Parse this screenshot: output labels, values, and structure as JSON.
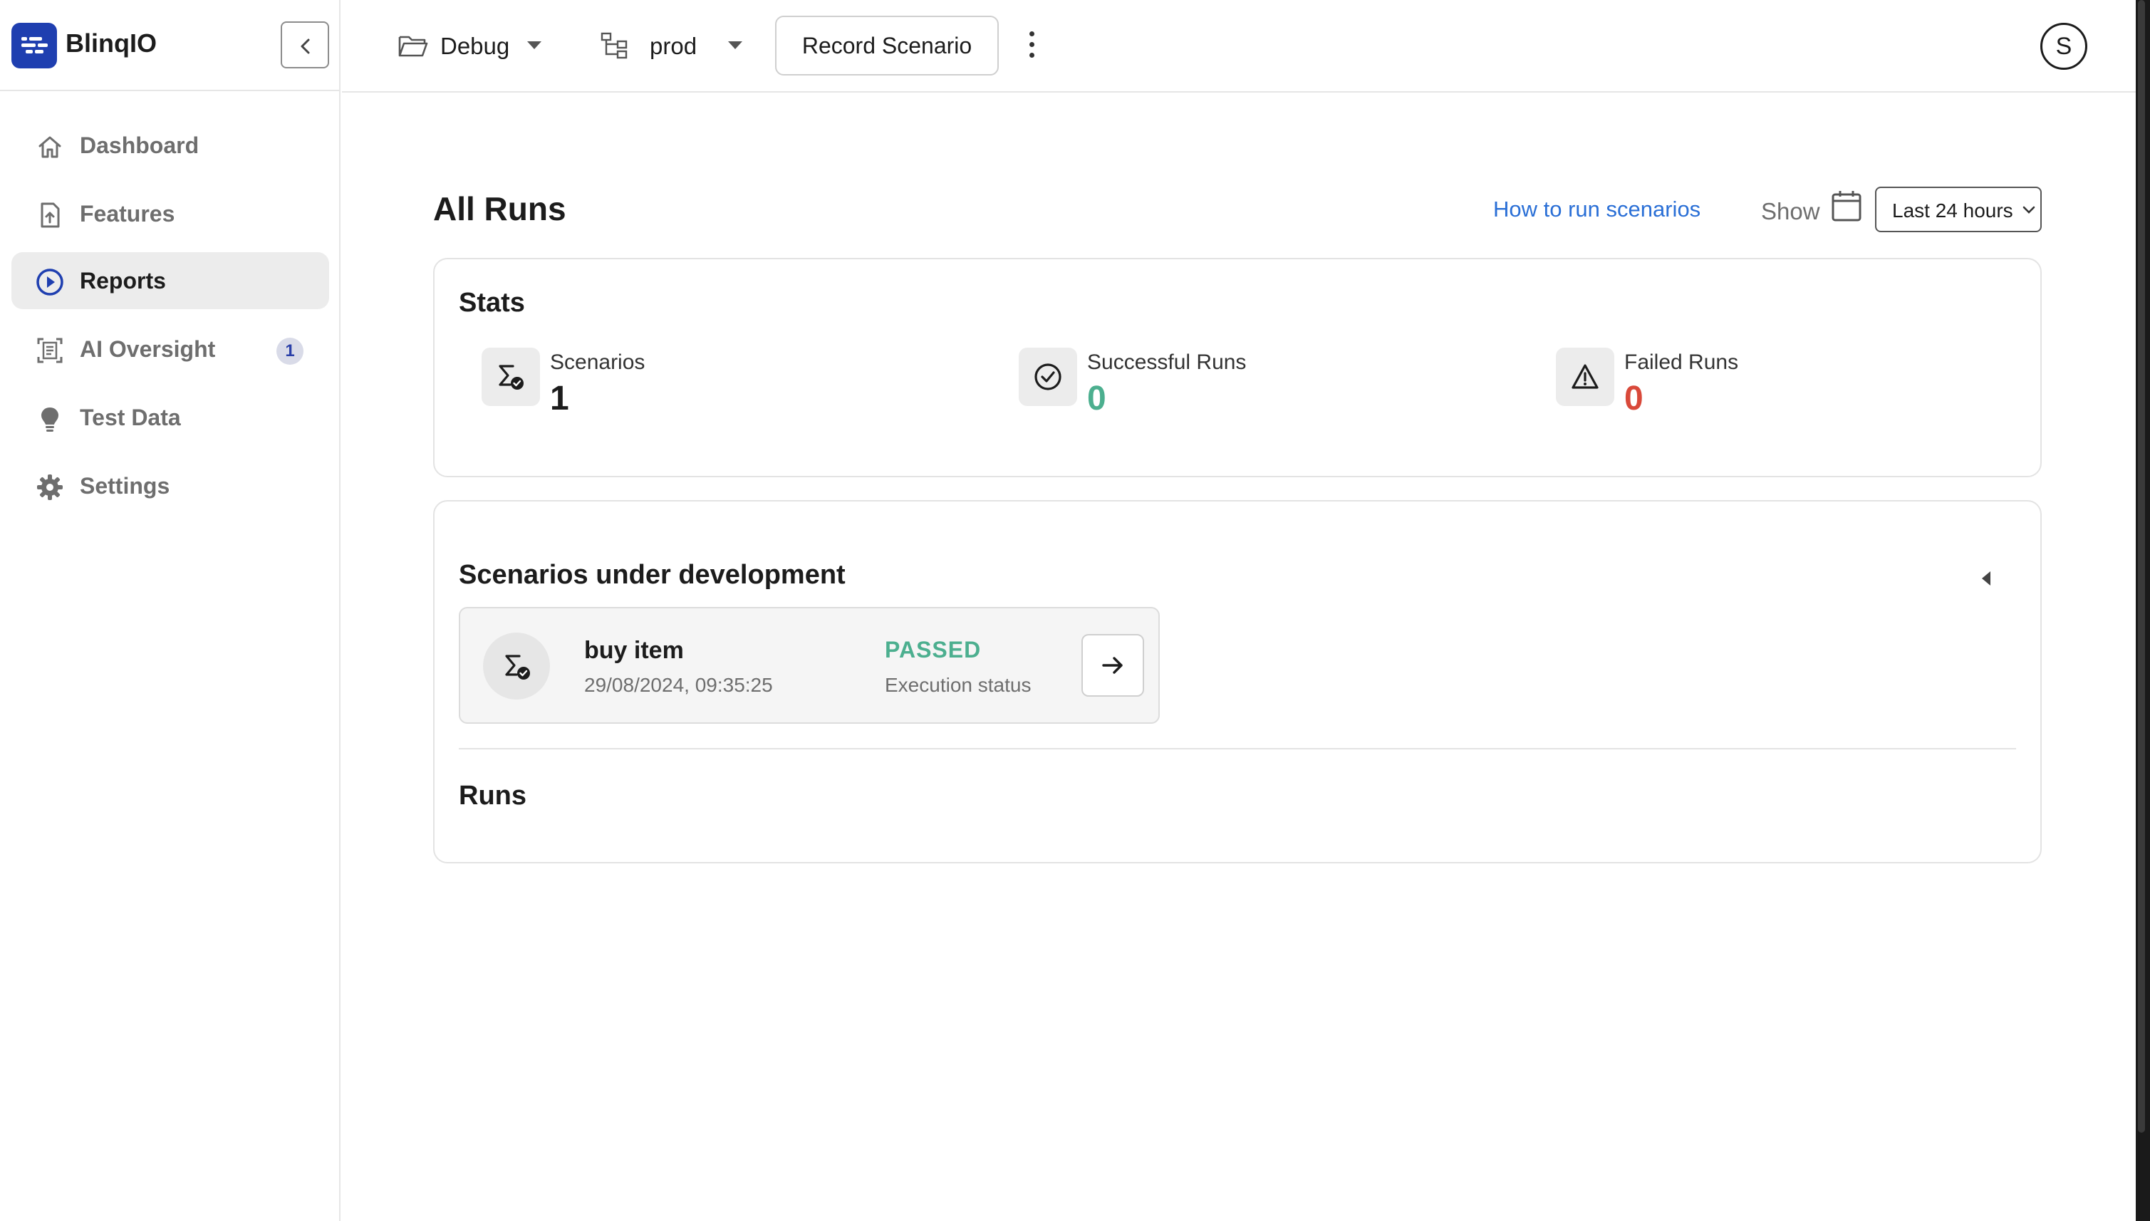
{
  "app": {
    "logo_text": "BlinqIO",
    "brand_color": "#1f3fb0"
  },
  "sidebar": {
    "items": [
      {
        "label": "Dashboard",
        "icon": "home-icon"
      },
      {
        "label": "Features",
        "icon": "file-upload-icon"
      },
      {
        "label": "Reports",
        "icon": "play-circle-icon",
        "active": true
      },
      {
        "label": "AI Oversight",
        "icon": "scan-document-icon",
        "badge": "1"
      },
      {
        "label": "Test Data",
        "icon": "lightbulb-icon"
      },
      {
        "label": "Settings",
        "icon": "gear-icon"
      }
    ]
  },
  "topbar": {
    "project": "Debug",
    "environment": "prod",
    "record_label": "Record Scenario",
    "avatar_initial": "S"
  },
  "main": {
    "title": "All Runs",
    "help_link": "How to run scenarios",
    "show_label": "Show",
    "range_value": "Last 24 hours",
    "stats": {
      "title": "Stats",
      "items": [
        {
          "label": "Scenarios",
          "value": "1",
          "color": "#1c1c1c",
          "icon": "sigma-check-icon"
        },
        {
          "label": "Successful Runs",
          "value": "0",
          "color": "#4caf8f",
          "icon": "check-circle-icon"
        },
        {
          "label": "Failed Runs",
          "value": "0",
          "color": "#d9493a",
          "icon": "warning-icon"
        }
      ]
    },
    "development": {
      "title": "Scenarios under development",
      "scenario": {
        "name": "buy item",
        "date": "29/08/2024, 09:35:25",
        "status": "PASSED",
        "status_label": "Execution status",
        "status_color": "#4caf8f"
      }
    },
    "runs_title": "Runs"
  }
}
